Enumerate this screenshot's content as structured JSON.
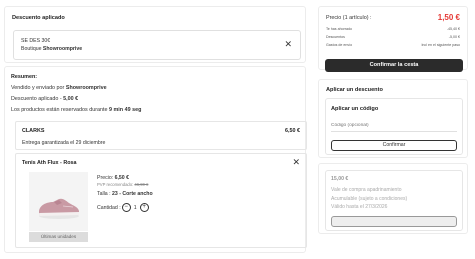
{
  "discount_applied": {
    "title": "Descuento aplicado",
    "code_line": "SE DES 30€",
    "boutique_prefix": "Boutique ",
    "boutique_name": "Showroomprive"
  },
  "summary": {
    "title": "Resumen:",
    "sold_by_prefix": "Vendido y enviado por ",
    "sold_by": "Showroomprive",
    "discount_prefix": "Descuento aplicado - ",
    "discount_value": "5,00 €",
    "reserved_prefix": "Los productos están reservados durante ",
    "reserved_time": "9 min 49 seg",
    "brand_box": {
      "brand": "CLARKS",
      "price": "6,50 €",
      "delivery": "Entrega garantizada el 29 diciembre"
    },
    "product": {
      "name": "Tenis Ath Flux - Rosa",
      "price_label": "Precio: ",
      "price": "6,50 €",
      "rrp_label": "PVP recomendado: ",
      "rrp": "46,90 €",
      "size_label": "Talla : ",
      "size": "23 - Corte ancho",
      "qty_label": "Cantidad : ",
      "qty_minus": "−",
      "qty_value": "1",
      "qty_plus": "+",
      "stock_badge": "Últimas unidades"
    }
  },
  "price_summary": {
    "label": "Precio (1 artículo) :",
    "total": "1,50 €",
    "rows": [
      {
        "label": "Te has ahorrado",
        "value": "-45,40 €"
      },
      {
        "label": "Descuentos",
        "value": "-5,00 €"
      },
      {
        "label": "Gastos de envío",
        "value": "Incl en el siguiente paso"
      }
    ],
    "confirm_label": "Confirmar la cesta"
  },
  "apply_discount": {
    "title": "Aplicar un descuento",
    "subtitle": "Aplicar un código",
    "input_placeholder": "Código (opcional)",
    "button_label": "Confirmar"
  },
  "voucher": {
    "amount": "15,00 €",
    "line1": "Vale de compra apadrinamiento",
    "line2": "Acumulable (sujeto a condiciones)",
    "line3": "Válido hasta el 27/3/2026"
  },
  "colors": {
    "total_price": "#e53935",
    "primary_button": "#2b2b2b"
  },
  "icons": {
    "remove_discount": "close-icon",
    "remove_product": "close-icon"
  }
}
